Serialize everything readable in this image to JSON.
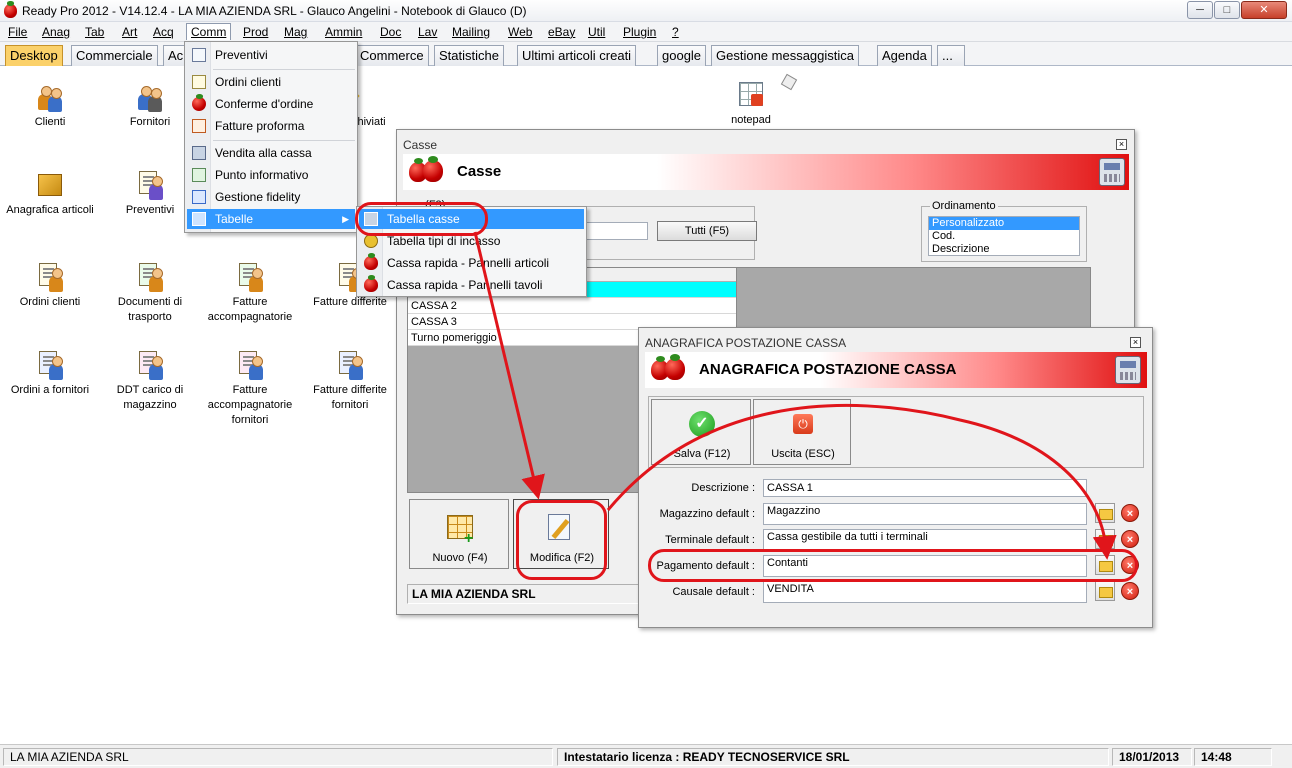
{
  "window": {
    "title": "Ready Pro 2012 - V14.12.4 - LA MIA AZIENDA SRL - Glauco Angelini - Notebook di Glauco (D)",
    "min": "─",
    "max": "□",
    "close": "✕"
  },
  "menubar": [
    "File",
    "Anag",
    "Tab",
    "Art",
    "Acq",
    "Comm",
    "Prod",
    "Mag",
    "Ammin",
    "Doc",
    "Lav",
    "Mailing",
    "Web",
    "eBay",
    "Util",
    "Plugin",
    "?"
  ],
  "tabs": [
    "Desktop",
    "Commerciale",
    "Ac",
    "Commerce",
    "Statistiche",
    "Ultimi articoli creati",
    "google",
    "Gestione messaggistica",
    "Agenda",
    "..."
  ],
  "desktop_icons": [
    {
      "label": "Clienti"
    },
    {
      "label": "Fornitori"
    },
    {
      "label": "Anagrafica articoli"
    },
    {
      "label": "Preventivi"
    },
    {
      "label": "Ordini clienti"
    },
    {
      "label": "Documenti di trasporto"
    },
    {
      "label": "Fatture accompagnatorie"
    },
    {
      "label": "Fatture differite"
    },
    {
      "label": "Ordini a fornitori"
    },
    {
      "label": "DDT carico di magazzino"
    },
    {
      "label": "Fatture accompagnatorie fornitori"
    },
    {
      "label": "Fatture differite fornitori"
    },
    {
      "label": "chiviati"
    },
    {
      "label": "notepad"
    }
  ],
  "comm_menu": [
    "Preventivi",
    "Ordini clienti",
    "Conferme d'ordine",
    "Fatture proforma",
    "Vendita alla cassa",
    "Punto informativo",
    "Gestione fidelity",
    "Tabelle"
  ],
  "submenu": [
    "Tabella casse",
    "Tabella tipi di incasso",
    "Cassa rapida - Pannelli articoli",
    "Cassa rapida - Pannelli tavoli"
  ],
  "casse": {
    "window_title": "Casse",
    "banner_title": "Casse",
    "filter_label": "...(F3)",
    "filter_value": "",
    "all_button": "Tutti (F5)",
    "sort_group": "Ordinamento",
    "sort_options": [
      "Personalizzato",
      "Cod.",
      "Descrizione"
    ],
    "rows": [
      "CASSA 1",
      "CASSA 2",
      "CASSA 3",
      "Turno pomeriggio"
    ],
    "new_button": "Nuovo (F4)",
    "edit_button": "Modifica (F2)",
    "company": "LA MIA AZIENDA SRL"
  },
  "postazione": {
    "window_title": "ANAGRAFICA POSTAZIONE CASSA",
    "banner_title": "ANAGRAFICA POSTAZIONE CASSA",
    "save_button": "Salva (F12)",
    "exit_button": "Uscita (ESC)",
    "labels": [
      "Descrizione :",
      "Magazzino default :",
      "Terminale default :",
      "Pagamento default :",
      "Causale default :"
    ],
    "values": [
      "CASSA 1",
      "Magazzino",
      "Cassa gestibile da tutti i terminali",
      "Contanti",
      "VENDITA"
    ]
  },
  "statusbar": {
    "company": "LA MIA AZIENDA SRL",
    "license": "Intestatario licenza : READY TECNOSERVICE SRL",
    "date": "18/01/2013",
    "time": "14:48"
  },
  "colors": {
    "accent": "#e0151b",
    "highlight": "#3399ff",
    "active_tab": "#fbd16a",
    "selected_row": "#00ffff"
  }
}
